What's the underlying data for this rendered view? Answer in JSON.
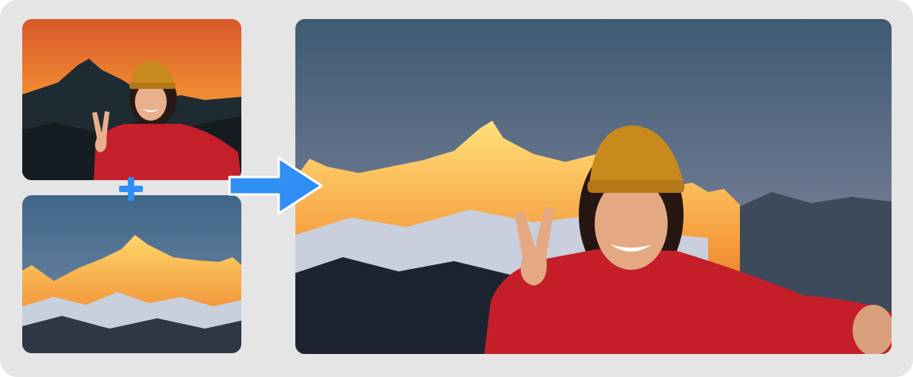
{
  "images": {
    "source_selfie": "selfie-at-sunset-image",
    "source_mountain": "snow-peak-at-sunrise-image",
    "result": "composited-selfie-with-peak-image"
  },
  "icons": {
    "combine": "plus-icon",
    "output": "arrow-right-icon"
  },
  "colors": {
    "frame": "#e5e5e5",
    "accent": "#2f8ff5"
  }
}
